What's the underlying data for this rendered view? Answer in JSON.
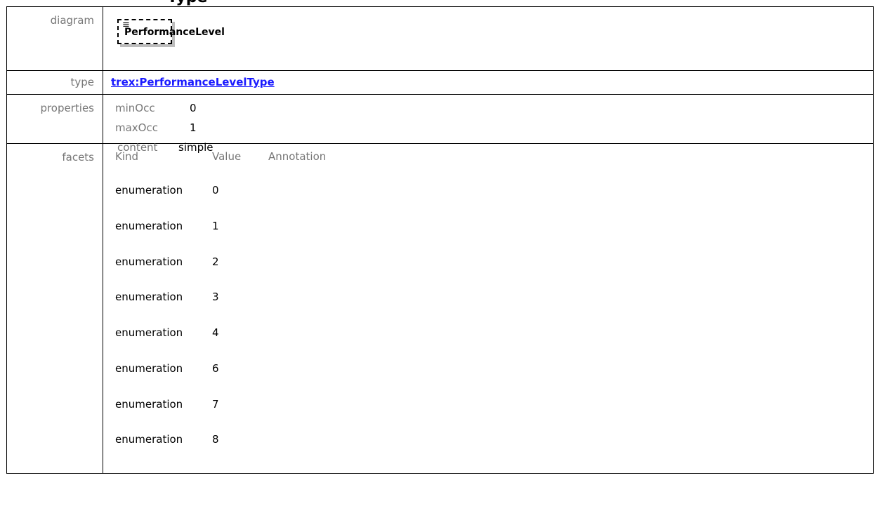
{
  "page": {
    "heading_fragment": "Type"
  },
  "labels": {
    "diagram": "diagram",
    "type": "type",
    "properties": "properties",
    "facets": "facets"
  },
  "diagram": {
    "element_name": "PerformanceLevel",
    "icon": "list-lines-icon"
  },
  "type": {
    "link_text": "trex:PerformanceLevelType",
    "link_color": "#1a1aff"
  },
  "properties": [
    {
      "key": "minOcc",
      "value": "0"
    },
    {
      "key": "maxOcc",
      "value": "1"
    },
    {
      "key": "content",
      "value": "simple"
    }
  ],
  "facets": {
    "headers": {
      "kind": "Kind",
      "value": "Value",
      "annotation": "Annotation"
    },
    "rows": [
      {
        "kind": "enumeration",
        "value": "0"
      },
      {
        "kind": "enumeration",
        "value": "1"
      },
      {
        "kind": "enumeration",
        "value": "2"
      },
      {
        "kind": "enumeration",
        "value": "3"
      },
      {
        "kind": "enumeration",
        "value": "4"
      },
      {
        "kind": "enumeration",
        "value": "6"
      },
      {
        "kind": "enumeration",
        "value": "7"
      },
      {
        "kind": "enumeration",
        "value": "8"
      }
    ]
  }
}
